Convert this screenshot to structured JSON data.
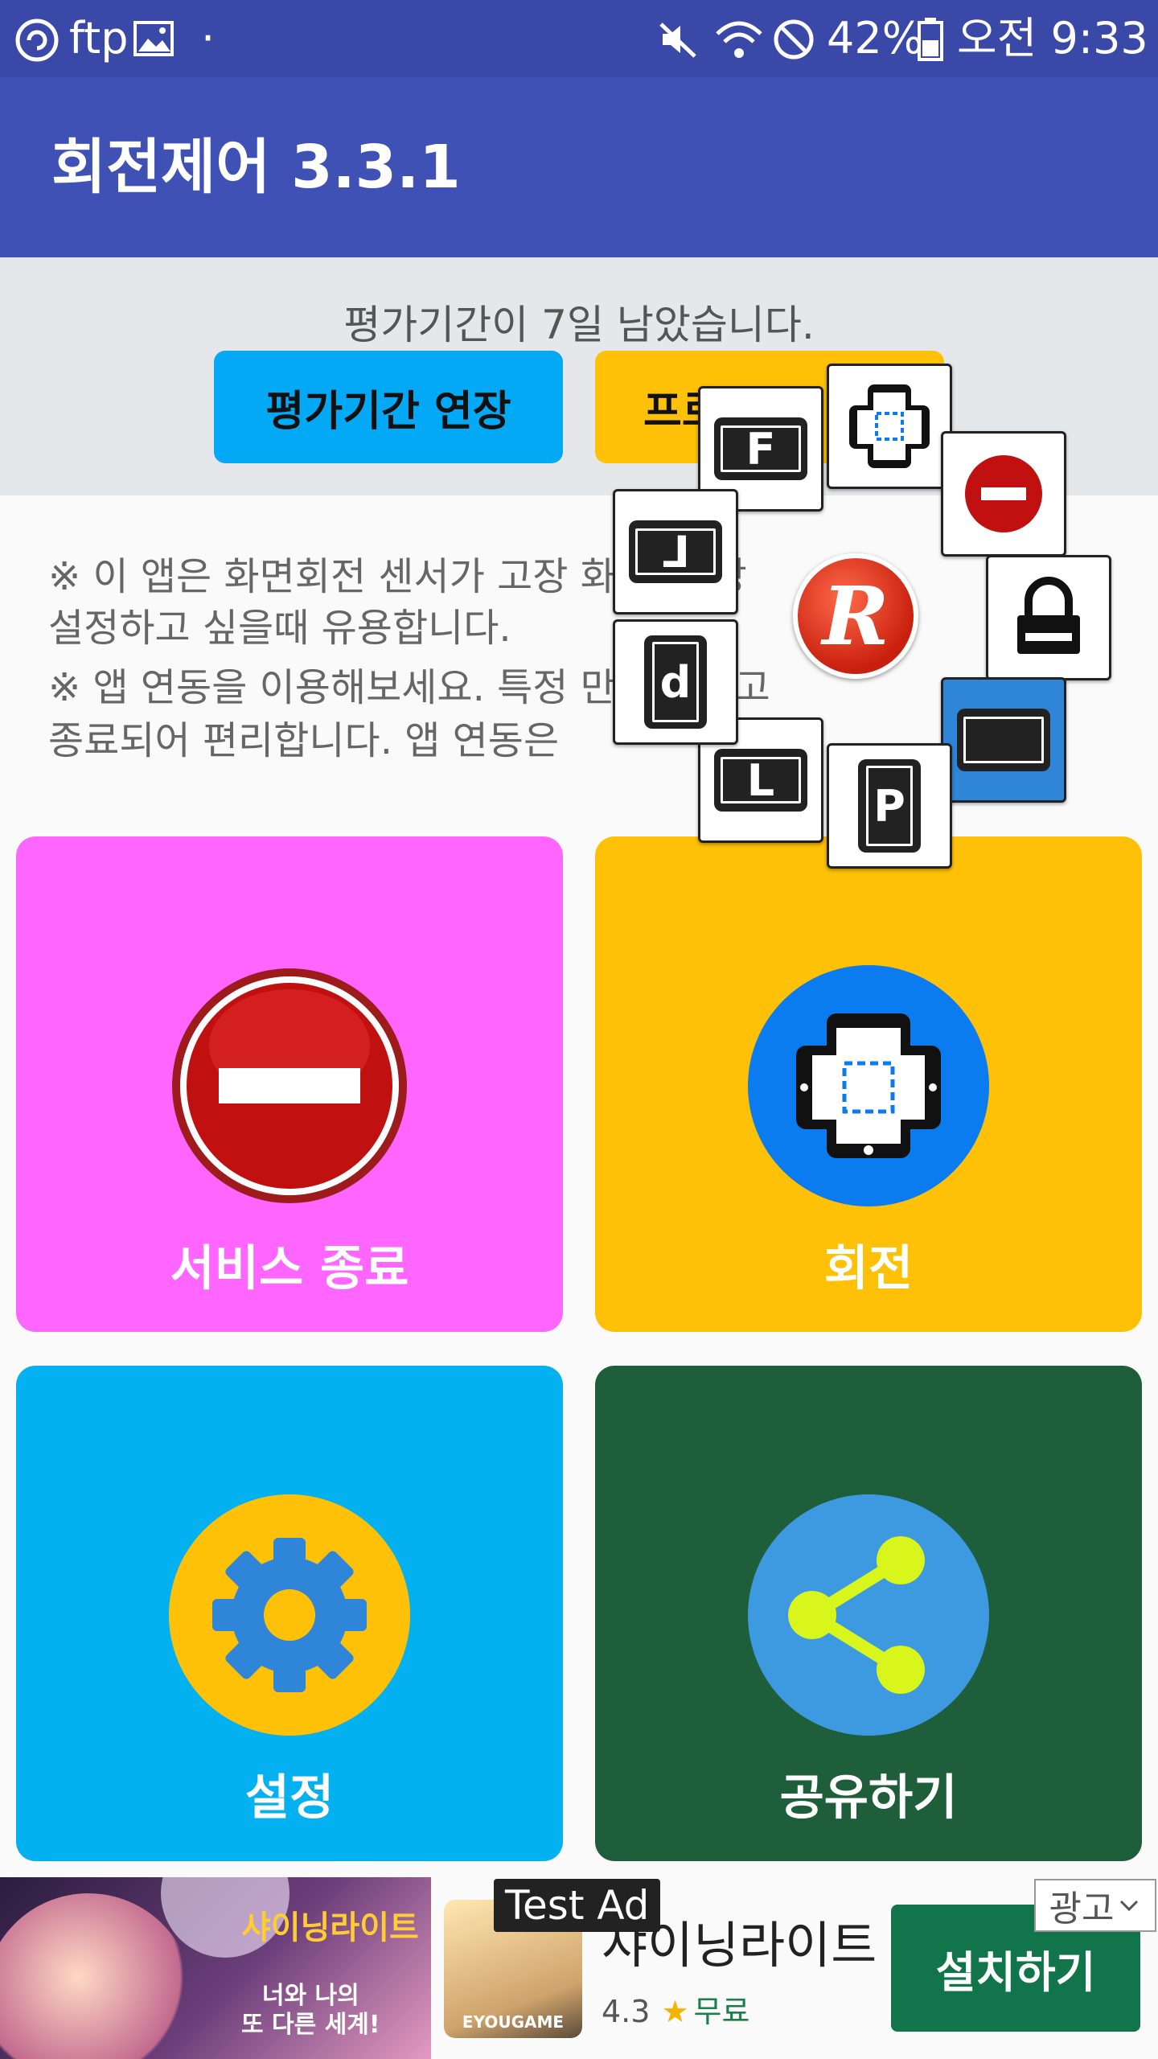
{
  "status_bar": {
    "left_text": "ftp",
    "dot": "·",
    "battery": "42%",
    "time": "오전 9:33",
    "icons": [
      "sync-icon",
      "image-icon",
      "mute-icon",
      "wifi-icon",
      "blocked-icon",
      "battery-icon"
    ]
  },
  "app_bar": {
    "title": "회전제어 3.3.1"
  },
  "trial": {
    "message": "평가기간이 7일 남았습니다.",
    "extend_label": "평가기간 연장",
    "pro_label": "프로"
  },
  "description": {
    "line1": "※ 이 앱은 화면회전 센서가 고장       화면     을 강",
    "line2": "설정하고 싶을때 유용합니다.",
    "line3": "※ 앱 연동을 이용해보세요. 특정      만 실행되고",
    "line4": "종료되어 편리합니다. 앱 연동은 "
  },
  "tiles": [
    {
      "label": "서비스 종료",
      "color": "#ff66ff",
      "icon": "stop-icon"
    },
    {
      "label": "회전",
      "color": "#ffc107",
      "icon": "rotate-phone-icon"
    },
    {
      "label": "설정",
      "color": "#03b0f0",
      "icon": "gear-icon"
    },
    {
      "label": "공유하기",
      "color": "#1e5e3a",
      "icon": "share-icon"
    }
  ],
  "overlay": {
    "center_letter": "R",
    "items": [
      {
        "letter": "F",
        "icon": "forward-landscape-icon"
      },
      {
        "letter": "",
        "icon": "auto-rotate-icon"
      },
      {
        "letter": "",
        "icon": "stop-icon"
      },
      {
        "letter": "",
        "icon": "lock-icon"
      },
      {
        "letter": "",
        "icon": "landscape-icon"
      },
      {
        "letter": "P",
        "icon": "portrait-icon"
      },
      {
        "letter": "L",
        "icon": "landscape-L-icon"
      },
      {
        "letter": "d",
        "icon": "reverse-portrait-icon"
      },
      {
        "letter": "⅃",
        "icon": "reverse-landscape-icon"
      }
    ]
  },
  "ad": {
    "test_label": "Test Ad",
    "badge": "광고",
    "game_logo": "샤이닝라이트",
    "game_tag_line1": "너와 나의",
    "game_tag_line2": "또 다른 세계!",
    "title": "샤이닝라이트",
    "rating": "4.3",
    "price": "무료",
    "install_label": "설치하기",
    "publisher": "EYOUGAME"
  }
}
